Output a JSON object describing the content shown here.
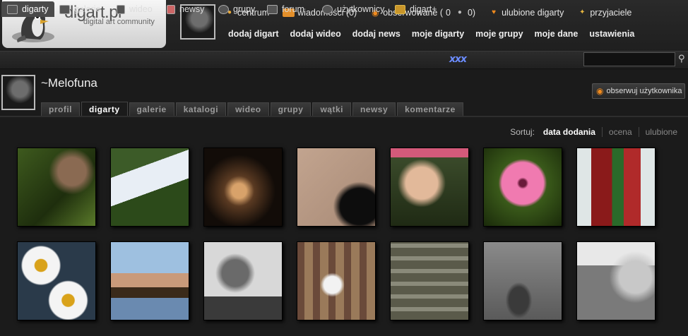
{
  "logo": {
    "title": "digart.pl",
    "subtitle": "digital art community",
    "mascot_icon": "penguin-icon"
  },
  "top_links": [
    {
      "label": "centrum",
      "icon": "user-icon"
    },
    {
      "label": "wiadomości (0)",
      "icon": "mail-icon"
    },
    {
      "label": "obserwowane (",
      "icon": "eye-icon"
    },
    {
      "label": "0",
      "icon": ""
    },
    {
      "label": "0)",
      "icon": "user-icon"
    },
    {
      "label": "ulubione digarty",
      "icon": "heart-icon"
    },
    {
      "label": "przyjaciele",
      "icon": "friends-icon"
    }
  ],
  "main_links": [
    "dodaj digart",
    "dodaj wideo",
    "dodaj news",
    "moje digarty",
    "moje grupy",
    "moje dane",
    "ustawienia"
  ],
  "nav": {
    "items": [
      {
        "label": "digarty",
        "icon": "images-icon",
        "active": true
      },
      {
        "label": "galerie",
        "icon": "gallery-icon"
      },
      {
        "label": "wideo",
        "icon": "film-icon"
      },
      {
        "label": "newsy",
        "icon": "news-icon"
      },
      {
        "label": "grupy",
        "icon": "group-icon"
      },
      {
        "label": "forum",
        "icon": "forum-icon"
      },
      {
        "label": "użytkownicy",
        "icon": "users-icon"
      },
      {
        "label": "digart+",
        "icon": "plus-user-icon"
      }
    ],
    "badge": "xxx",
    "search_value": ""
  },
  "profile": {
    "username": "~Melofuna",
    "follow_label": "obserwuj użytkownika",
    "tabs": [
      "profil",
      "digarty",
      "galerie",
      "katalogi",
      "wideo",
      "grupy",
      "wątki",
      "newsy",
      "komentarze"
    ],
    "active_tab": "digarty"
  },
  "sort": {
    "label": "Sortuj:",
    "options": [
      "data dodania",
      "ocena",
      "ulubione"
    ],
    "selected": "data dodania"
  },
  "thumbnails": [
    {
      "description": "man-with-sunglasses-and-flower"
    },
    {
      "description": "sign-ruchu-oporu"
    },
    {
      "description": "woman-in-dark-with-light"
    },
    {
      "description": "black-white-cat-on-fabric"
    },
    {
      "description": "smiling-boy-in-cap"
    },
    {
      "description": "pink-flower"
    },
    {
      "description": "glass-bottle-colorful"
    },
    {
      "description": "daisies"
    },
    {
      "description": "hand-with-bracelets"
    },
    {
      "description": "shadow-and-sneakers"
    },
    {
      "description": "white-dog-behind-fence"
    },
    {
      "description": "stone-stairs"
    },
    {
      "description": "old-door-bw"
    },
    {
      "description": "elderly-woman-bw"
    }
  ],
  "colors": {
    "accent": "#f08a1d",
    "background": "#1b1b1b",
    "active_tab": "#4a4a4a"
  }
}
